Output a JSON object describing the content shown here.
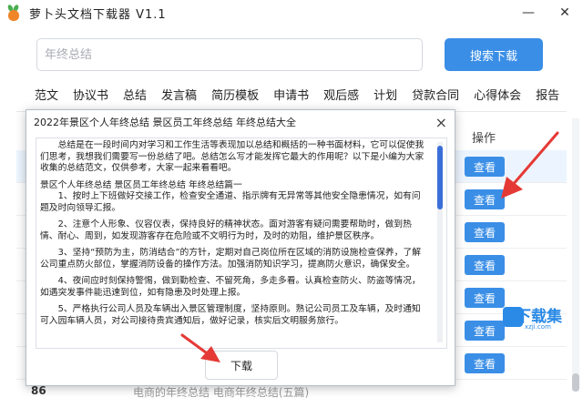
{
  "app": {
    "title": "萝卜头文档下载器  V1.1",
    "window_buttons": {
      "minimize": "—",
      "close": "✕"
    }
  },
  "search": {
    "placeholder": "年终总结",
    "button_label": "搜索下载"
  },
  "categories": [
    "范文",
    "协议书",
    "总结",
    "发言稿",
    "简历模板",
    "申请书",
    "观后感",
    "计划",
    "贷款合同",
    "心得体会",
    "报告"
  ],
  "table": {
    "header_op": "操作",
    "view_label": "查看",
    "bottom_row": {
      "num": "86",
      "title": "电商的年终总结 电商年终总结(五篇)"
    }
  },
  "modal": {
    "title": "2022年景区个人年终总结  景区员工年终总结  年终总结大全",
    "close_label": "×",
    "paragraphs": [
      "总结是在一段时间内对学习和工作生活等表现加以总结和概括的一种书面材料，它可以促使我们思考，我想我们需要写一份总结了吧。总结怎么写才能发挥它最大的作用呢？以下是小编为大家收集的总结范文，仅供参考，大家一起来看看吧。",
      "景区个人年终总结  景区员工年终总结  年终总结篇一",
      "1、按时上下班做好交接工作，检查安全通道、指示牌有无异常等其他安全隐患情况，如有问题及时向领导汇报。",
      "2、注意个人形象、仪容仪表，保持良好的精神状态。面对游客有疑问需要帮助时，做到热情、耐心、周到，如发现游客存在危险或不文明行为时，及时的劝阻，维护景区秩序。",
      "3、坚持“预防为主，防消结合”的方针，定期对自己岗位所在区域的消防设施检查保养，了解公司重点防火部位，掌握消防设备的操作方法。加强消防知识学习，提高防火意识，确保安全。",
      "4、夜间应时刻保持警惕，做到勤检查、不留死角，多走多看。认真检查防火、防盗等情况，如遇突发事件能迅速到位，如有隐患及时处理上报。",
      "5、严格执行公司人员及车辆出入景区管理制度，坚持原则。熟记公司员工及车辆，及时通知可入园车辆人员，对公司接待贵宾通知后，做好记录，核实后文明服务旅行。"
    ],
    "download_label": "下载"
  },
  "watermark": {
    "brand": "下载集",
    "sub": "xzji.com"
  },
  "colors": {
    "primary": "#3a8ee6",
    "arrow": "#e53935",
    "selected_row": "#ecf5ff"
  }
}
